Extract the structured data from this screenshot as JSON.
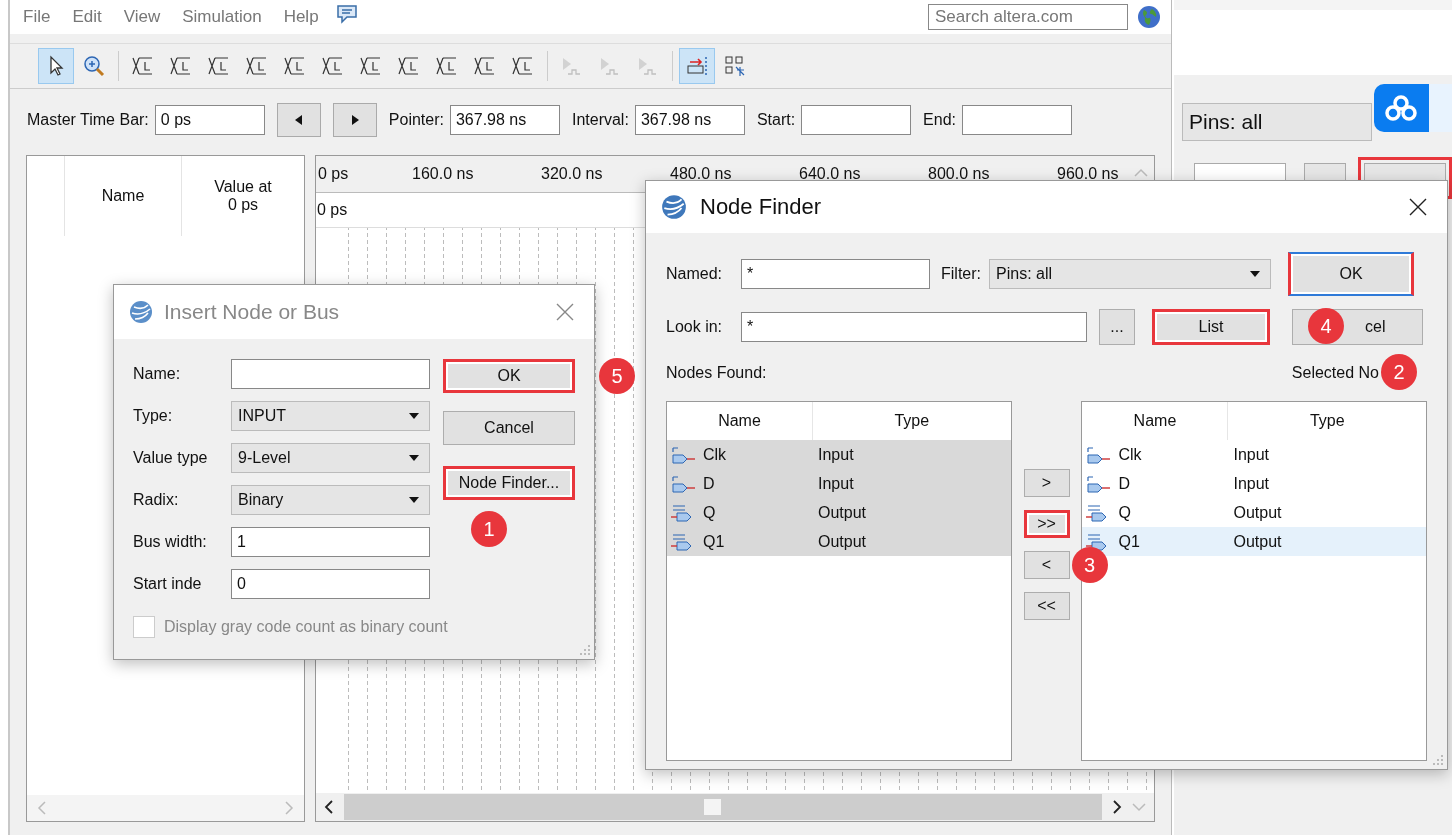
{
  "menu": [
    "File",
    "Edit",
    "View",
    "Simulation",
    "Help"
  ],
  "search": {
    "placeholder": "Search altera.com"
  },
  "toolbar": [
    {
      "kind": "pointer",
      "selected": true,
      "disabled": false
    },
    {
      "kind": "zoom",
      "selected": false,
      "disabled": false
    },
    {
      "kind": "separator"
    },
    {
      "kind": "wave",
      "selected": false,
      "disabled": false
    },
    {
      "kind": "wave",
      "selected": false,
      "disabled": false
    },
    {
      "kind": "wave",
      "selected": false,
      "disabled": false
    },
    {
      "kind": "wave",
      "selected": false,
      "disabled": false
    },
    {
      "kind": "wave",
      "selected": false,
      "disabled": false
    },
    {
      "kind": "wave",
      "selected": false,
      "disabled": false
    },
    {
      "kind": "wave",
      "selected": false,
      "disabled": false
    },
    {
      "kind": "wave",
      "selected": false,
      "disabled": false
    },
    {
      "kind": "wave",
      "selected": false,
      "disabled": false
    },
    {
      "kind": "wave",
      "selected": false,
      "disabled": false
    },
    {
      "kind": "wave",
      "selected": false,
      "disabled": false
    },
    {
      "kind": "separator"
    },
    {
      "kind": "sim",
      "selected": false,
      "disabled": true
    },
    {
      "kind": "sim",
      "selected": false,
      "disabled": true
    },
    {
      "kind": "sim",
      "selected": false,
      "disabled": true
    },
    {
      "kind": "separator"
    },
    {
      "kind": "marker",
      "selected": true,
      "disabled": false
    },
    {
      "kind": "grid",
      "selected": false,
      "disabled": false
    }
  ],
  "time_bar": {
    "master": {
      "label": "Master Time Bar:",
      "value": "0 ps"
    },
    "pointer": {
      "label": "Pointer:",
      "value": "367.98 ns"
    },
    "interval": {
      "label": "Interval:",
      "value": "367.98 ns"
    },
    "start": {
      "label": "Start:"
    },
    "end": {
      "label": "End:"
    }
  },
  "signal_table": {
    "columns": [
      "Name",
      "Value at 0 ps"
    ]
  },
  "waveform": {
    "ruler": [
      "0 ps",
      "160.0 ns",
      "320.0 ns",
      "480.0 ns",
      "640.0 ns",
      "800.0 ns",
      "960.0 ns"
    ],
    "cursor": "0 ps"
  },
  "background_window": {
    "filter": "Pins: all"
  },
  "insert_dialog": {
    "title": "Insert Node or Bus",
    "fields": [
      {
        "label": "Name:",
        "kind": "text"
      },
      {
        "label": "Type:",
        "kind": "select",
        "value": "INPUT"
      },
      {
        "label": "Value type",
        "kind": "select",
        "value": "9-Level"
      },
      {
        "label": "Radix:",
        "kind": "select",
        "value": "Binary"
      },
      {
        "label": "Bus width:",
        "kind": "text",
        "value": "1"
      },
      {
        "label": "Start inde",
        "kind": "text",
        "value": "0"
      }
    ],
    "checkbox": {
      "label": "Display gray code count as binary count",
      "checked": false,
      "disabled": true
    },
    "buttons": [
      {
        "label": "OK",
        "highlighted": true,
        "badge": "5"
      },
      {
        "label": "Cancel",
        "highlighted": false
      },
      {
        "label": "Node Finder...",
        "highlighted": true,
        "badge": "1"
      }
    ]
  },
  "node_finder": {
    "title": "Node Finder",
    "named": {
      "label": "Named:",
      "value": "*"
    },
    "filter": {
      "label": "Filter:",
      "value": "Pins: all"
    },
    "look_in": {
      "label": "Look in:",
      "value": "*"
    },
    "browse": "...",
    "ok": {
      "label": "OK",
      "highlighted": true,
      "default": true
    },
    "list": {
      "label": "List",
      "highlighted": true
    },
    "cancel": {
      "label": "cel",
      "highlighted": false,
      "badge": "4"
    },
    "found": {
      "label": "Nodes Found:",
      "columns": [
        "Name",
        "Type"
      ],
      "rows": [
        {
          "kind": "in",
          "name": "Clk",
          "type": "Input",
          "selected": true
        },
        {
          "kind": "in",
          "name": "D",
          "type": "Input",
          "selected": true
        },
        {
          "kind": "out",
          "name": "Q",
          "type": "Output",
          "selected": true
        },
        {
          "kind": "out",
          "name": "Q1",
          "type": "Output",
          "selected": true
        }
      ]
    },
    "moves": [
      {
        "label": ">",
        "highlighted": false
      },
      {
        "label": ">>",
        "highlighted": true
      },
      {
        "label": "<",
        "highlighted": false,
        "badge": "3"
      },
      {
        "label": "<<",
        "highlighted": false
      }
    ],
    "selected": {
      "label": "Selected No",
      "badge": "2",
      "columns": [
        "Name",
        "Type"
      ],
      "rows": [
        {
          "kind": "in",
          "name": "Clk",
          "type": "Input",
          "selected": false
        },
        {
          "kind": "in",
          "name": "D",
          "type": "Input",
          "selected": false
        },
        {
          "kind": "out",
          "name": "Q",
          "type": "Output",
          "selected": false
        },
        {
          "kind": "out",
          "name": "Q1",
          "type": "Output",
          "selected": true
        }
      ]
    }
  }
}
